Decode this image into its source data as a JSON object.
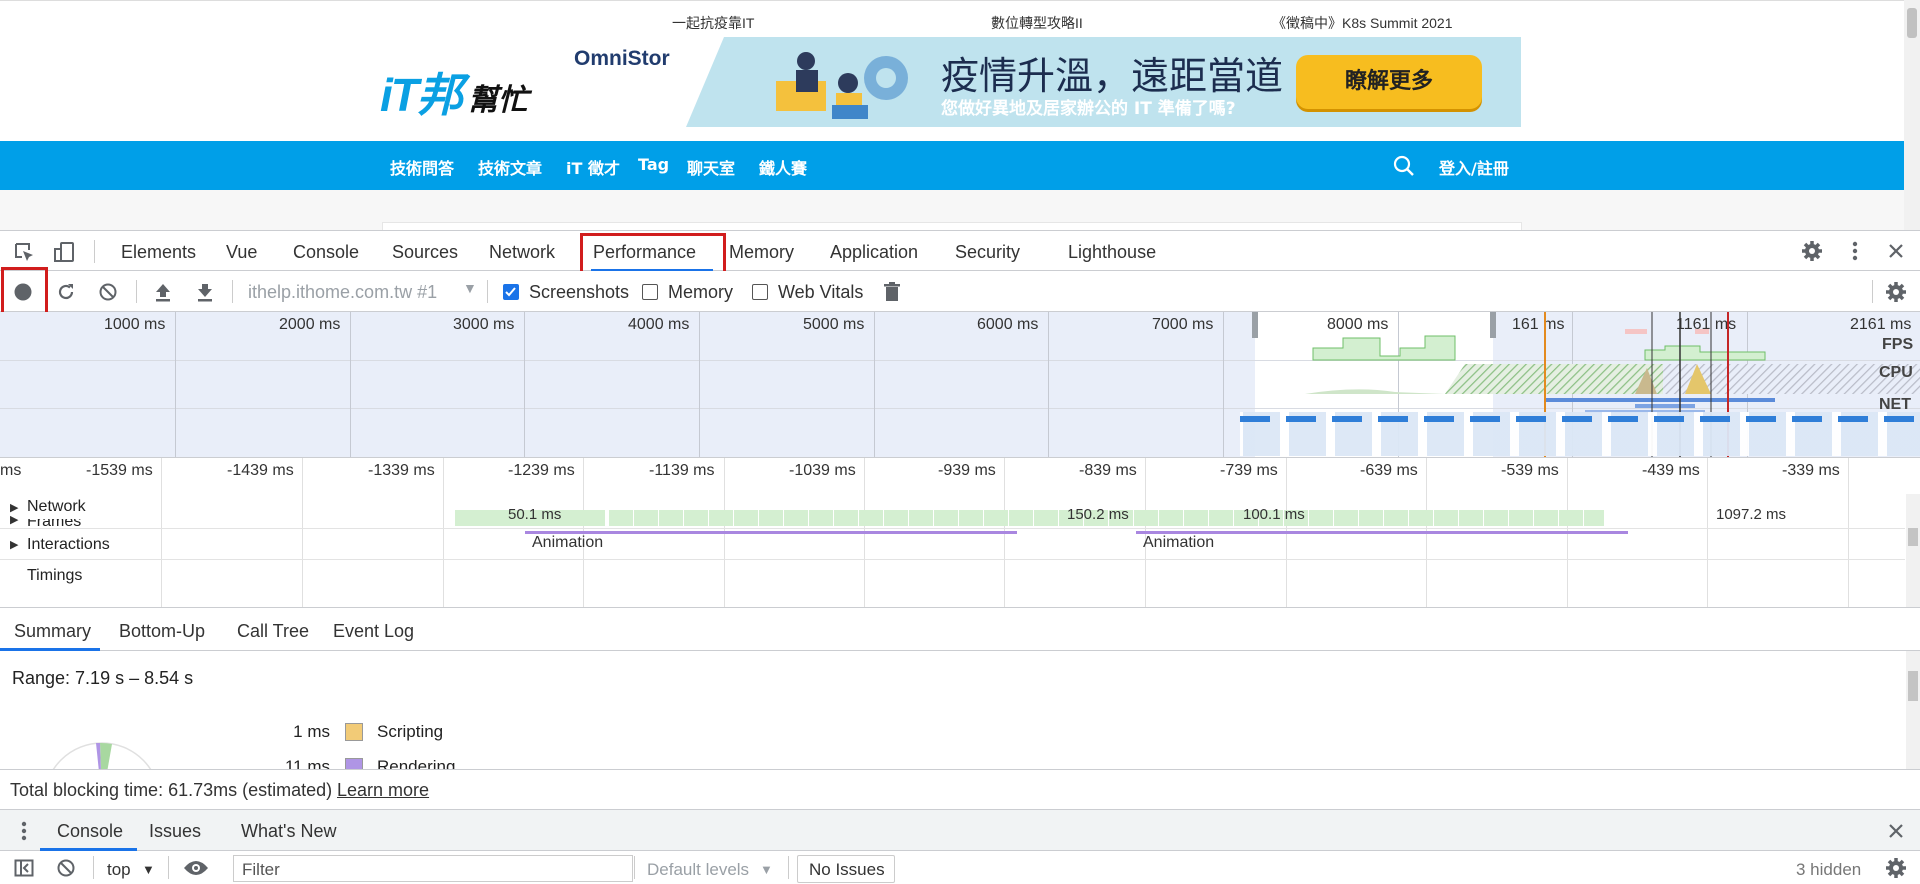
{
  "site": {
    "top_links": [
      "一起抗疫靠IT",
      "數位轉型攻略II",
      "《徵稿中》K8s Summit 2021"
    ],
    "logo": "iT邦",
    "logo_sub": "幫忙",
    "banner": {
      "brand": "OmniStor",
      "title": "疫情升溫，遠距當道",
      "subtitle": "您做好異地及居家辦公的 IT 準備了嗎?",
      "cta": "瞭解更多",
      "colors": {
        "bg": "#bfe3ee",
        "cta": "#f7bd1f"
      }
    },
    "nav": [
      "技術問答",
      "技術文章",
      "iT 徵才",
      "Tag",
      "聊天室",
      "鐵人賽"
    ],
    "login": "登入/註冊",
    "nav_color": "#009fe8"
  },
  "devtools": {
    "tabs": [
      "Elements",
      "Vue",
      "Console",
      "Sources",
      "Network",
      "Performance",
      "Memory",
      "Application",
      "Security",
      "Lighthouse"
    ],
    "active_tab": "Performance",
    "toolbar": {
      "target": "ithelp.ithome.com.tw #1",
      "screenshots_label": "Screenshots",
      "screenshots_checked": true,
      "memory_label": "Memory",
      "memory_checked": false,
      "web_vitals_label": "Web Vitals",
      "web_vitals_checked": false
    },
    "overview": {
      "ticks": [
        "1000 ms",
        "2000 ms",
        "3000 ms",
        "4000 ms",
        "5000 ms",
        "6000 ms",
        "7000 ms",
        "8000 ms",
        "161 ms",
        "1161 ms",
        "2161 ms"
      ],
      "lanes": [
        "FPS",
        "CPU",
        "NET"
      ]
    },
    "timeline": {
      "ticks": [
        "ms",
        "-1539 ms",
        "-1439 ms",
        "-1339 ms",
        "-1239 ms",
        "-1139 ms",
        "-1039 ms",
        "-939 ms",
        "-839 ms",
        "-739 ms",
        "-639 ms",
        "-539 ms",
        "-439 ms",
        "-339 ms"
      ],
      "rows": {
        "network": "Network",
        "frames": "Frames",
        "interactions": "Interactions",
        "timings": "Timings"
      },
      "frame_labels": [
        "50.1 ms",
        "150.2 ms",
        "100.1 ms",
        "1097.2 ms"
      ],
      "animation_label": "Animation"
    },
    "summary_tabs": [
      "Summary",
      "Bottom-Up",
      "Call Tree",
      "Event Log"
    ],
    "summary": {
      "range": "Range: 7.19 s – 8.54 s",
      "legend": [
        {
          "value": "1 ms",
          "name": "Scripting",
          "color": "#f2cb77"
        },
        {
          "value": "11 ms",
          "name": "Rendering",
          "color": "#af95e5"
        }
      ]
    },
    "blocking": {
      "text": "Total blocking time: 61.73ms (estimated)",
      "link": "Learn more"
    },
    "drawer_tabs": [
      "Console",
      "Issues",
      "What's New"
    ],
    "console": {
      "context": "top",
      "filter_placeholder": "Filter",
      "levels": "Default levels",
      "issues": "No Issues",
      "hidden": "3 hidden"
    }
  }
}
